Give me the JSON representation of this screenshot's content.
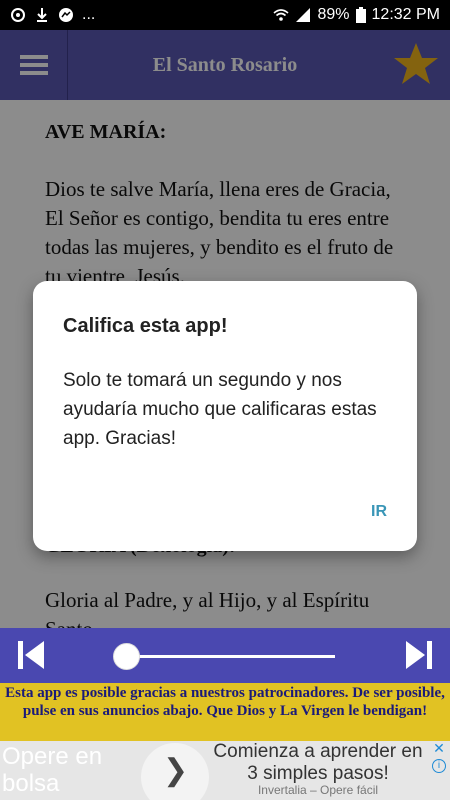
{
  "status_bar": {
    "battery": "89%",
    "time": "12:32 PM",
    "more": "..."
  },
  "app_bar": {
    "title": "El Santo Rosario",
    "menu_icon": "hamburger-menu-icon",
    "star_icon": "star-icon",
    "star_color": "#f1b51c",
    "bar_color": "#5a58b2"
  },
  "content": {
    "heading1": "AVE MARÍA:",
    "paragraph1": "Dios te salve María, llena eres de Gracia, El Señor es contigo, bendita tu eres entre todas las mujeres, y bendito es el fruto de tu vientre, Jesús.",
    "heading2": "GLORIA (Doxología):",
    "paragraph2": "Gloria al Padre, y al Hijo, y al Espíritu Santo"
  },
  "dialog": {
    "title": "Califica esta app!",
    "message": "Solo te tomará un segundo y nos ayudaría mucho que calificaras estas app. Gracias!",
    "action": "IR",
    "action_color": "#3a96b7"
  },
  "player": {
    "prev_icon": "skip-previous-icon",
    "next_icon": "skip-next-icon",
    "progress": 0.0
  },
  "sponsor": {
    "text": "Esta app es posible gracias a nuestros patrocinadores. De ser posible, pulse en sus anuncios abajo. Que Dios y La Virgen le bendigan!",
    "bg_color": "#e1c223"
  },
  "ad": {
    "left_text": "Opere en bolsa",
    "headline": "Comienza a aprender en 3 simples pasos!",
    "source": "Invertalia – Opere fácil",
    "arrow_icon": "chevron-right-icon",
    "close_icon": "close-icon",
    "info_icon": "info-icon"
  }
}
